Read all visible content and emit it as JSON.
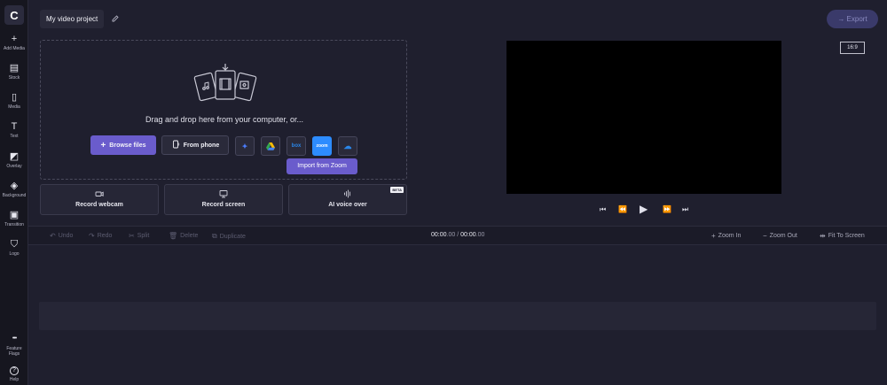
{
  "sidebar": {
    "logo": "C",
    "items": [
      {
        "icon": "plus-icon",
        "glyph": "+",
        "label": "Add Media"
      },
      {
        "icon": "stock-icon",
        "glyph": "▤",
        "label": "Stock"
      },
      {
        "icon": "media-icon",
        "glyph": "▯",
        "label": "Media"
      },
      {
        "icon": "text-icon",
        "glyph": "T",
        "label": "Text"
      },
      {
        "icon": "overlay-icon",
        "glyph": "◩",
        "label": "Overlay"
      },
      {
        "icon": "background-icon",
        "glyph": "◈",
        "label": "Background"
      },
      {
        "icon": "transition-icon",
        "glyph": "▣",
        "label": "Transition"
      },
      {
        "icon": "logo-icon",
        "glyph": "⛉",
        "label": "Logo"
      }
    ],
    "bottom": [
      {
        "icon": "more-icon",
        "glyph": "•••",
        "label": "Feature Flags"
      },
      {
        "icon": "help-icon",
        "glyph": "?",
        "label": "Help"
      }
    ]
  },
  "header": {
    "project_title": "My video project",
    "export_label": "Export"
  },
  "import": {
    "drop_text": "Drag and drop here from your computer, or...",
    "browse_label": "Browse files",
    "phone_label": "From phone",
    "services": [
      {
        "name": "dropbox-icon",
        "glyph": "✦",
        "color": "#4a7dff"
      },
      {
        "name": "google-drive-icon",
        "glyph": "▲",
        "color": "#34a853"
      },
      {
        "name": "box-icon",
        "glyph": "box",
        "color": "#2a86e8"
      },
      {
        "name": "zoom-icon",
        "glyph": "zoom",
        "color": "#ffffff"
      },
      {
        "name": "onedrive-icon",
        "glyph": "☁",
        "color": "#2a86e8"
      }
    ],
    "tooltip": "Import from Zoom"
  },
  "record": {
    "webcam_label": "Record webcam",
    "screen_label": "Record screen",
    "voice_label": "AI voice over",
    "beta_badge": "BETA"
  },
  "preview": {
    "aspect_ratio": "16:9"
  },
  "timeline": {
    "undo": "Undo",
    "redo": "Redo",
    "split": "Split",
    "delete": "Delete",
    "duplicate": "Duplicate",
    "time_current": "00:00",
    "time_current_ms": ".00",
    "time_separator": " / ",
    "time_total": "00:00",
    "time_total_ms": ".00",
    "zoom_in": "Zoom In",
    "zoom_out": "Zoom Out",
    "fit": "Fit To Screen"
  },
  "colors": {
    "accent": "#6a5ccc",
    "background": "#1f1f2e"
  }
}
